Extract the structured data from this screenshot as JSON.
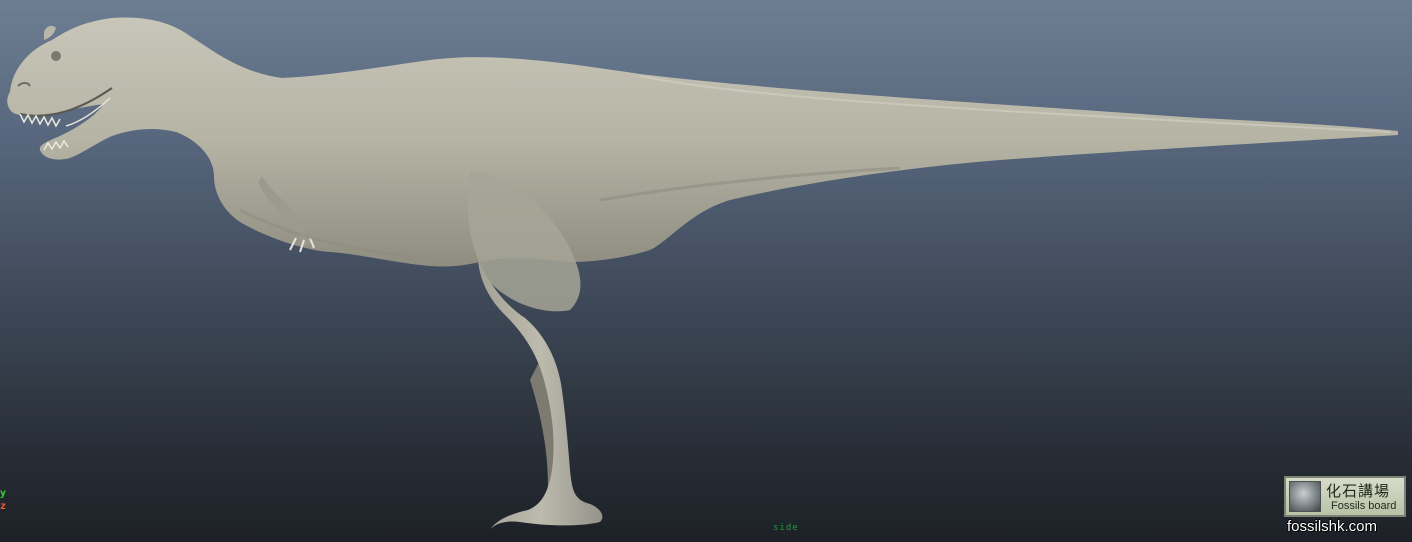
{
  "viewport": {
    "panel_name": "side",
    "background_top": "#6d7e93",
    "background_bottom": "#1d2127"
  },
  "axis_indicator": {
    "y_label": "y",
    "z_label": "z",
    "y_color": "#3bd23b",
    "z_color": "#ff5a2a"
  },
  "model": {
    "subject": "theropod dinosaur sculpt",
    "view": "side",
    "color": "#b9b7a9"
  },
  "watermark": {
    "title_zh": "化石講場",
    "title_en": "Fossils board",
    "site": "fossilshk.com",
    "emblem_icon": "fossil-emblem-icon"
  }
}
